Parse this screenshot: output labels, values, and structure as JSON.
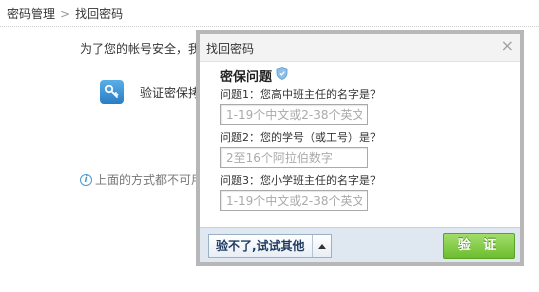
{
  "breadcrumb": {
    "parent": "密码管理",
    "separator": ">",
    "current": "找回密码"
  },
  "page": {
    "intro": "为了您的帐号安全，我",
    "method_label": "验证密保拷",
    "hint": "上面的方式都不可用"
  },
  "dialog": {
    "title": "找回密码",
    "close_glyph": "×",
    "section_title": "密保问题",
    "questions": [
      {
        "label": "问题1：您高中班主任的名字是？",
        "placeholder": "1-19个中文或2-38个英文",
        "value": ""
      },
      {
        "label": "问题2：您的学号（或工号）是？",
        "placeholder": "2至16个阿拉伯数字",
        "value": ""
      },
      {
        "label": "问题3：您小学班主任的名字是？",
        "placeholder": "1-19个中文或2-38个英文",
        "value": ""
      }
    ],
    "alt_button": "验不了,试试其他",
    "verify_button": "验 证"
  },
  "icons": {
    "key": "key-icon",
    "info": "info-icon",
    "shield": "shield-icon",
    "caret": "caret-up-icon",
    "close": "close-icon"
  },
  "colors": {
    "accent_green": "#7cc63f",
    "footer_blue": "#dfe8f0",
    "dialog_border": "#b7b7b7",
    "key_blue": "#3a8fd6"
  }
}
